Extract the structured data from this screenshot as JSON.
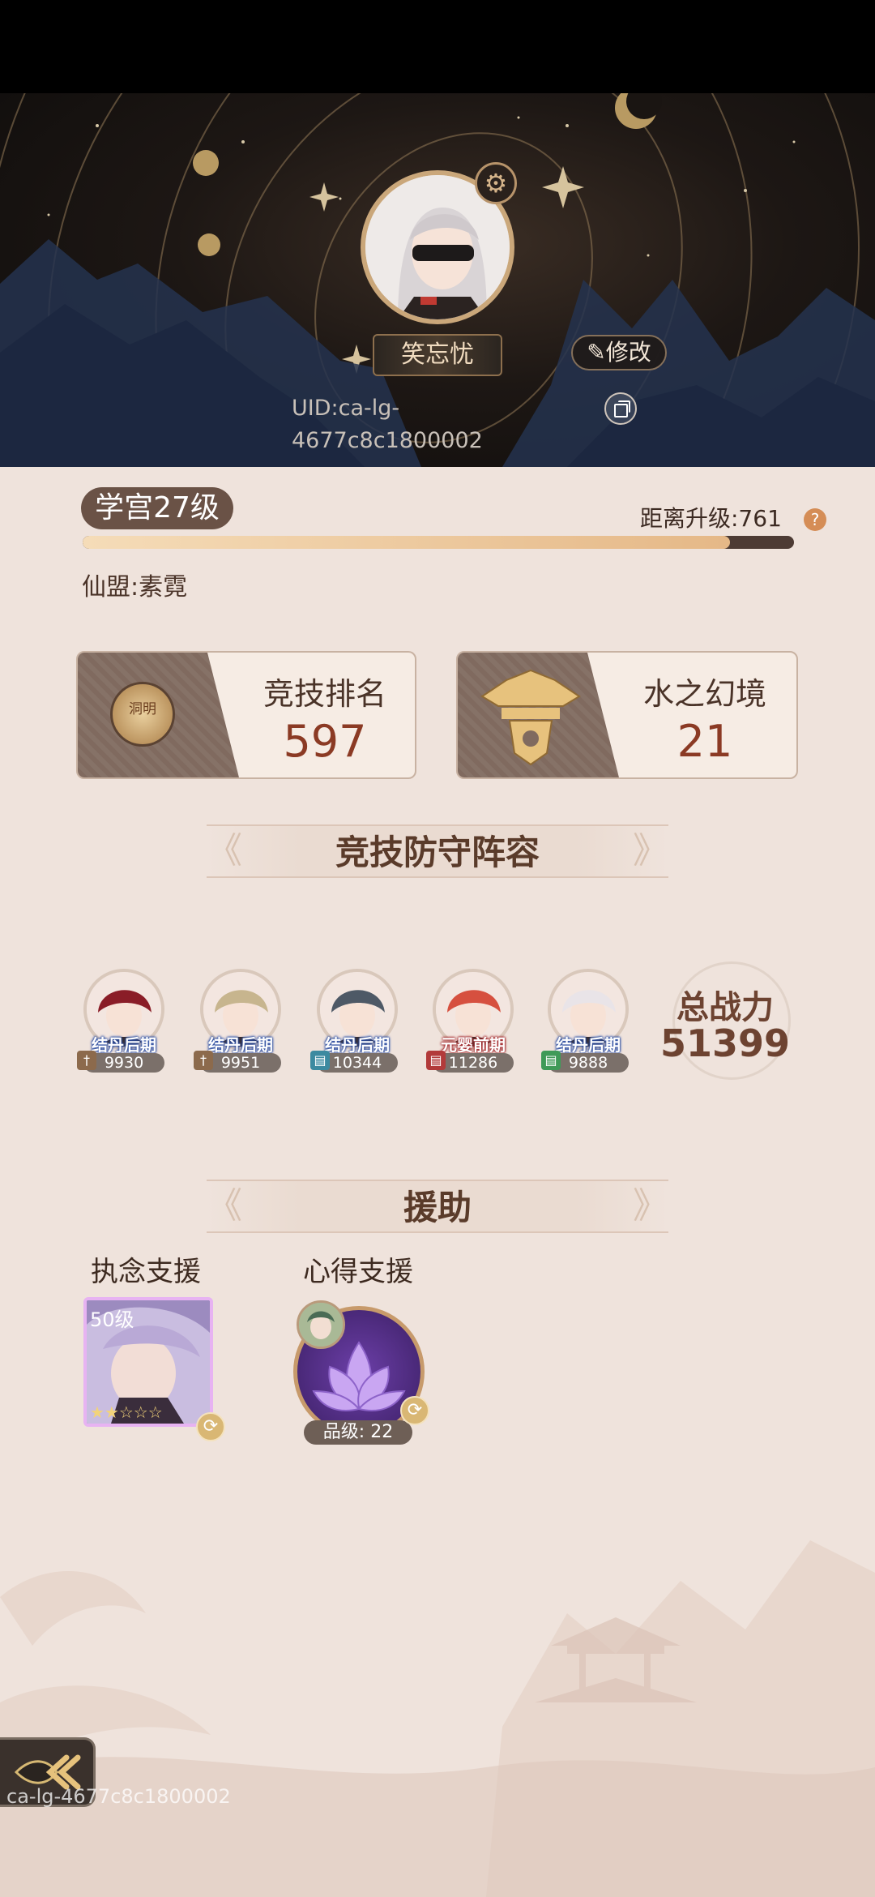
{
  "profile": {
    "name": "笑忘忧",
    "edit_label": "修改",
    "uid": "UID:ca-lg-4677c8c1800002"
  },
  "level": {
    "badge": "学宫27级",
    "remaining": "距离升级:761",
    "progress": 0.91
  },
  "alliance": "仙盟:素霓",
  "stats": {
    "arena": {
      "title": "竞技排名",
      "value": "597",
      "emblem_text": "洞明"
    },
    "water": {
      "title": "水之幻境",
      "value": "21"
    }
  },
  "defense": {
    "header": "竞技防守阵容",
    "heroes": [
      {
        "realm": "结丹后期",
        "power": "9930",
        "type_icon": "sword-icon",
        "type_color": "#8c6a4c",
        "hair": "#8a1d27"
      },
      {
        "realm": "结丹后期",
        "power": "9951",
        "type_icon": "sword-icon",
        "type_color": "#8c6a4c",
        "hair": "#c7b58e"
      },
      {
        "realm": "结丹后期",
        "power": "10344",
        "type_icon": "scroll-icon",
        "type_color": "#3c8aa0",
        "hair": "#4e5966"
      },
      {
        "realm": "元婴前期",
        "power": "11286",
        "type_icon": "scroll-icon",
        "type_color": "#b23a3a",
        "hair": "#d6503f"
      },
      {
        "realm": "结丹后期",
        "power": "9888",
        "type_icon": "scroll-icon",
        "type_color": "#3f9a58",
        "hair": "#e9e4e8"
      }
    ],
    "total_power_label": "总战力",
    "total_power": "51399"
  },
  "support": {
    "header": "援助",
    "obsession": {
      "label": "执念支援",
      "level": "50级",
      "stars": "★★☆☆☆"
    },
    "insight": {
      "label": "心得支援",
      "grade": "品级: 22"
    }
  },
  "watermark": "ca-lg-4677c8c1800002",
  "colors": {
    "accent_dark": "#806a5f",
    "value_red": "#8b3a24",
    "page_bg": "#efe3dc"
  }
}
